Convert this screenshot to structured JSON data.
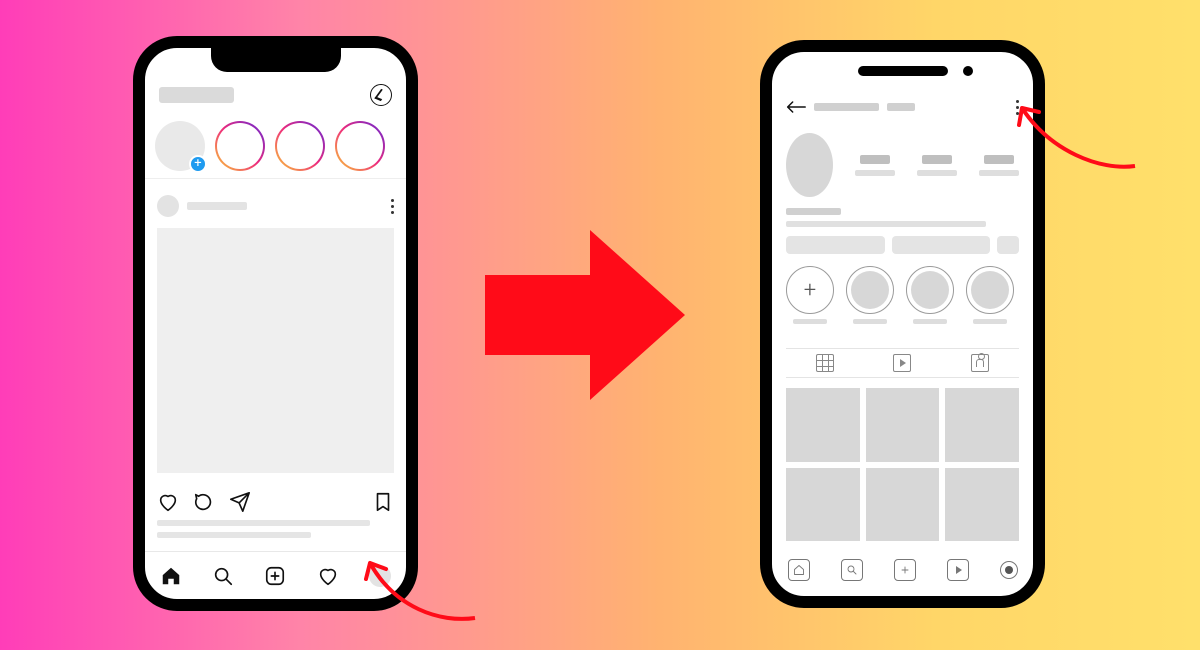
{
  "diagram": {
    "description": "Two phone mockups with a red arrow: navigate from the Instagram feed's profile tab to the profile screen's more-options menu.",
    "left_phone": {
      "style": "notch",
      "screen": "feed",
      "header": {
        "logo": "placeholder",
        "messenger_icon": "messenger-icon"
      },
      "stories": {
        "your_story": {
          "has_add_badge": true,
          "badge_glyph": "+"
        },
        "others_count": 3
      },
      "post": {
        "author_avatar": "placeholder",
        "author_name": "placeholder",
        "more_icon": "vertical-dots",
        "image": "placeholder",
        "actions": [
          "like-icon",
          "comment-icon",
          "share-icon",
          "bookmark-icon"
        ]
      },
      "bottom_nav": [
        "home-icon",
        "search-icon",
        "create-icon",
        "activity-heart-icon",
        "profile-avatar"
      ],
      "callout_target": "profile-avatar"
    },
    "right_phone": {
      "style": "pill",
      "screen": "profile",
      "header": {
        "back_icon": "back-arrow",
        "username": "placeholder",
        "more_icon": "vertical-dots"
      },
      "stats_count": 3,
      "action_buttons": [
        "wide",
        "wide",
        "square"
      ],
      "highlights": {
        "add_glyph": "+",
        "items_count": 3
      },
      "content_tabs": [
        "grid-tab-icon",
        "reels-tab-icon",
        "tagged-tab-icon"
      ],
      "grid_tiles": 6,
      "bottom_nav": [
        "home-icon",
        "search-icon",
        "create-icon",
        "reels-icon",
        "profile-icon"
      ],
      "callout_target": "more-options-icon"
    },
    "center_arrow_color": "#ff0b18"
  }
}
